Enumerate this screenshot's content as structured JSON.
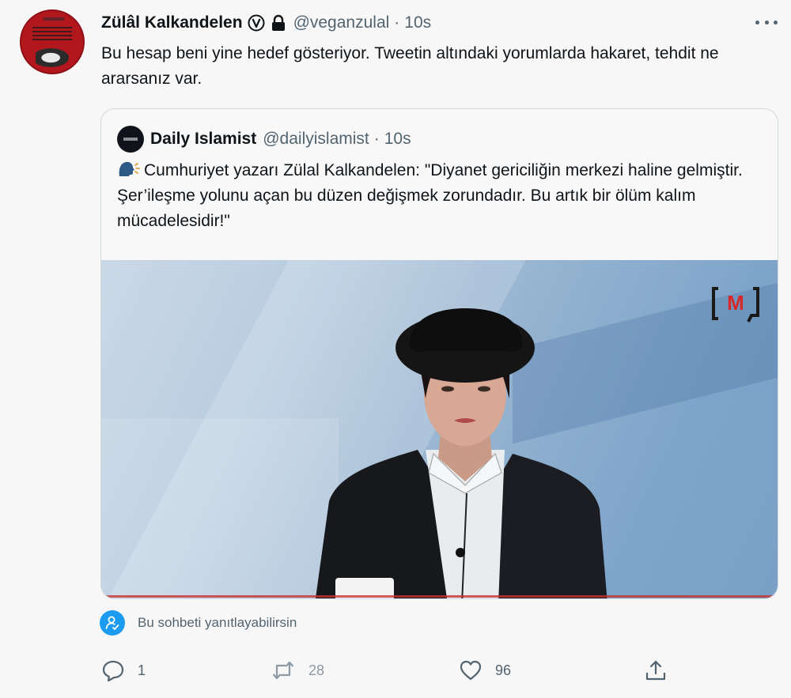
{
  "author": {
    "name": "Zülâl Kalkandelen",
    "handle": "@veganzulal",
    "time": "10s"
  },
  "tweet": {
    "text": "Bu hesap beni yine hedef gösteriyor. Tweetin altındaki yorumlarda hakaret, tehdit ne ararsanız var."
  },
  "quote": {
    "name": "Daily Islamist",
    "handle": "@dailyislamist",
    "time": "10s",
    "text": "Cumhuriyet yazarı Zülal Kalkandelen: \"Diyanet gericiliğin merkezi haline gelmiştir. Şer’ileşme yolunu açan bu düzen değişmek zorundadır. Bu artık bir ölüm kalım mücadelesidir!\"",
    "media_logo": "M"
  },
  "reply_restriction": {
    "text": "Bu sohbeti yanıtlayabilirsin"
  },
  "actions": {
    "replies": "1",
    "retweets": "28",
    "likes": "96"
  },
  "icons": {
    "verified": "v-circle-icon",
    "lock": "lock-icon",
    "more": "more-icon",
    "speaking": "speaking-head-icon",
    "reply": "reply-icon",
    "retweet": "retweet-icon",
    "like": "heart-icon",
    "share": "share-icon"
  },
  "colors": {
    "accent": "#1d9bf0",
    "secondary_text": "#536471",
    "primary_text": "#0f1419",
    "border": "#cfd9de",
    "media_logo_red": "#d62828"
  }
}
